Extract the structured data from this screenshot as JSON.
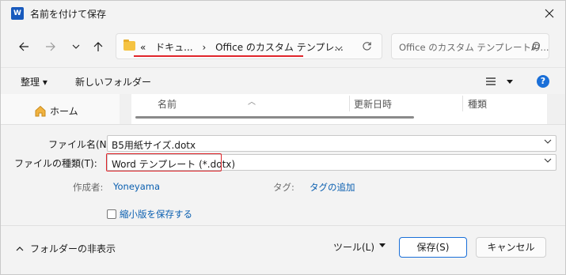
{
  "window": {
    "title": "名前を付けて保存",
    "app_icon_letter": "W"
  },
  "navbar": {
    "breadcrumb": [
      "«",
      "ドキュ...",
      "›",
      "Office のカスタム テンプレ..."
    ],
    "search_placeholder": "Office のカスタム テンプレートの..."
  },
  "command_bar": {
    "organize_label": "整理 ▾",
    "new_folder_label": "新しいフォルダー",
    "help_label": "?"
  },
  "nav_pane": {
    "home_label": "ホーム"
  },
  "file_list": {
    "columns": [
      "名前",
      "更新日時",
      "種類"
    ]
  },
  "form": {
    "filename_label": "ファイル名(N):",
    "filename_value": "B5用紙サイズ.dotx",
    "filetype_label": "ファイルの種類(T):",
    "filetype_value": "Word テンプレート (*.dotx)",
    "author_label": "作成者:",
    "author_value": "Yoneyama",
    "tags_label": "タグ:",
    "tags_value": "タグの追加",
    "thumbnail_label": "縮小版を保存する"
  },
  "footer": {
    "hide_folders_label": "フォルダーの非表示",
    "tools_label": "ツール(L)",
    "save_label": "保存(S)",
    "cancel_label": "キャンセル"
  },
  "colors": {
    "accent": "#1a6fd8",
    "highlight_red": "#e0242a",
    "link": "#0a5fb0"
  }
}
